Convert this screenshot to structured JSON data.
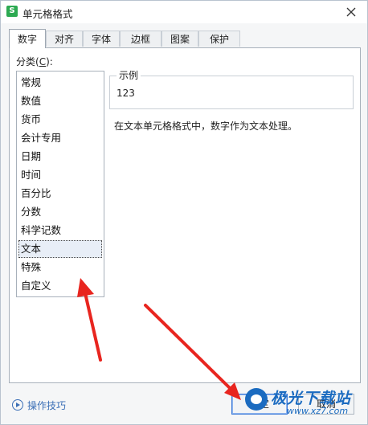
{
  "window": {
    "title": "单元格格式",
    "app_icon_letter": "S",
    "close_icon": "close-icon"
  },
  "tabs": [
    {
      "label": "数字",
      "active": true
    },
    {
      "label": "对齐",
      "active": false
    },
    {
      "label": "字体",
      "active": false
    },
    {
      "label": "边框",
      "active": false
    },
    {
      "label": "图案",
      "active": false
    },
    {
      "label": "保护",
      "active": false
    }
  ],
  "category": {
    "label_prefix": "分类(",
    "label_key": "C",
    "label_suffix": "):",
    "items": [
      "常规",
      "数值",
      "货币",
      "会计专用",
      "日期",
      "时间",
      "百分比",
      "分数",
      "科学记数",
      "文本",
      "特殊",
      "自定义"
    ],
    "selected": "文本"
  },
  "sample": {
    "title": "示例",
    "value": "123"
  },
  "description": "在文本单元格格式中，数字作为文本处理。",
  "footer": {
    "tips_label": "操作技巧",
    "ok_label": "确定",
    "cancel_label": "取消"
  },
  "watermark": {
    "text": "极光下载站",
    "url": "www.xz7.com"
  },
  "colors": {
    "accent": "#3a78d8",
    "annotation_arrow": "#e8251f",
    "link": "#3b6fb6"
  }
}
